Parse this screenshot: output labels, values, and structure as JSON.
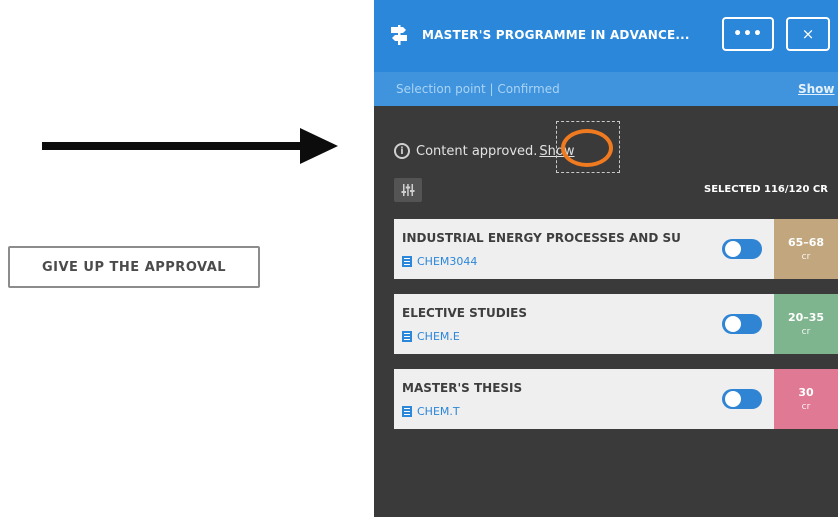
{
  "left": {
    "give_up_label": "GIVE UP THE APPROVAL"
  },
  "panel": {
    "header": {
      "title": "MASTER'S PROGRAMME IN ADVANCE...",
      "more_label": "•••",
      "close_label": "×",
      "accent": "#2b87d9"
    },
    "subheader": {
      "status": "Selection point | Confirmed",
      "show_label": "Show"
    },
    "content_status": {
      "info_glyph": "i",
      "text": "Content approved.",
      "show_link": "Show"
    },
    "selected": "SELECTED 116/120 CR",
    "courses": [
      {
        "name": "INDUSTRIAL ENERGY PROCESSES AND SU",
        "code": "CHEM3044",
        "enabled": true,
        "credits": "65–68",
        "unit": "cr",
        "color": "#c2a77e"
      },
      {
        "name": "ELECTIVE STUDIES",
        "code": "CHEM.E",
        "enabled": true,
        "credits": "20–35",
        "unit": "cr",
        "color": "#7fb58e"
      },
      {
        "name": "MASTER'S THESIS",
        "code": "CHEM.T",
        "enabled": true,
        "credits": "30",
        "unit": "cr",
        "color": "#e07a94"
      }
    ]
  }
}
